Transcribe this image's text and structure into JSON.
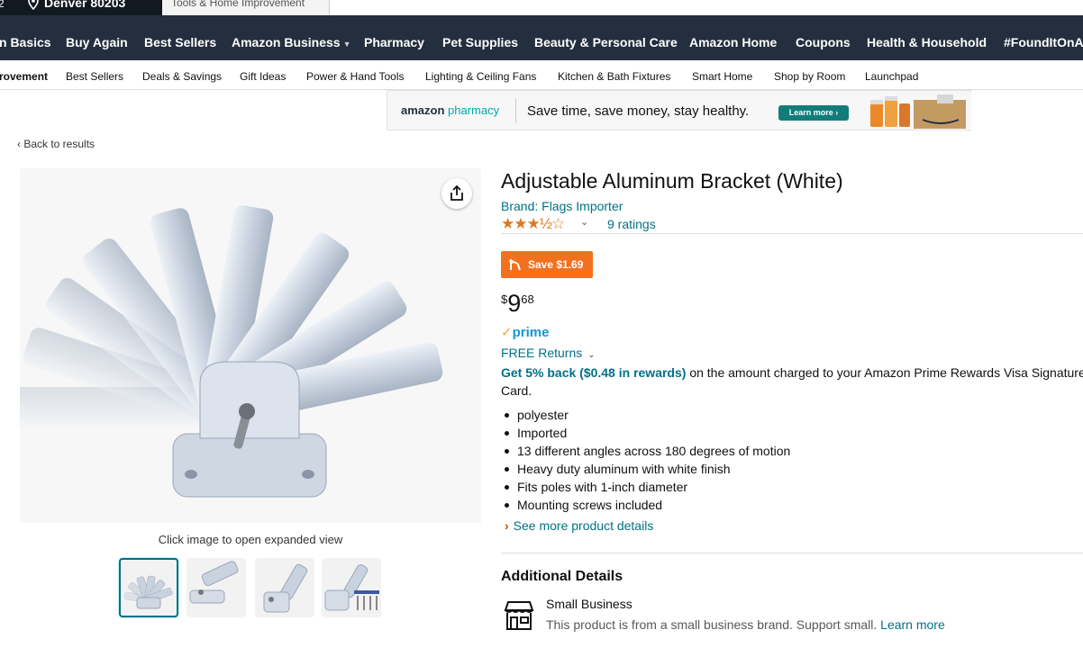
{
  "header": {
    "deliver_location": "Denver 80203",
    "search_category": "Tools & Home Improvement",
    "nav_items": [
      "n Basics",
      "Buy Again",
      "Best Sellers",
      "Amazon Business",
      "Pharmacy",
      "Pet Supplies",
      "Beauty & Personal Care",
      "Amazon Home",
      "Coupons",
      "Health & Household",
      "#FoundItOnAm"
    ],
    "sub_nav": [
      "rovement",
      "Best Sellers",
      "Deals & Savings",
      "Gift Ideas",
      "Power & Hand Tools",
      "Lighting & Ceiling Fans",
      "Kitchen & Bath Fixtures",
      "Smart Home",
      "Shop by Room",
      "Launchpad"
    ]
  },
  "banner": {
    "logo_amazon": "amazon",
    "logo_pharmacy": "pharmacy",
    "text": "Save time, save money, stay healthy.",
    "button": "Learn more ›"
  },
  "back_link": "‹  Back to results",
  "image": {
    "hint": "Click image to open expanded view"
  },
  "product": {
    "title": "Adjustable Aluminum Bracket (White)",
    "brand": "Brand: Flags Importer",
    "stars": "★★★½☆",
    "rating_value": 3.5,
    "ratings": "9 ratings",
    "save_badge": "Save $1.69",
    "price_symbol": "$",
    "price_whole": "9",
    "price_fraction": "68",
    "prime": "prime",
    "free_returns": "FREE Returns",
    "rewards_bold": "Get 5% back ($0.48 in rewards)",
    "rewards_rest": " on the amount charged to your Amazon Prime Rewards Visa Signature Card.",
    "bullets": [
      "polyester",
      "Imported",
      "13 different angles across 180 degrees of motion",
      "Heavy duty aluminum with white finish",
      "Fits poles with 1-inch diameter",
      "Mounting screws included"
    ],
    "see_more": "See more product details"
  },
  "additional": {
    "title": "Additional Details",
    "small_business_title": "Small Business",
    "small_business_desc": "This product is from a small business brand. Support small. ",
    "learn_more": "Learn more"
  },
  "colors": {
    "nav_bg": "#232f3e",
    "top_bg": "#131921",
    "link": "#007185",
    "save_badge": "#f3711e",
    "star": "#de7921"
  }
}
